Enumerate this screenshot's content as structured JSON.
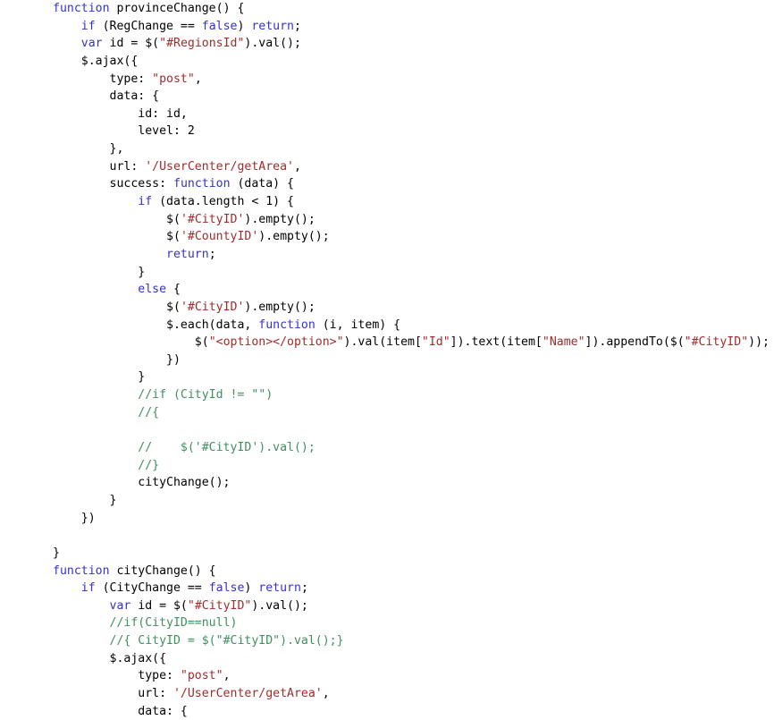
{
  "document": {
    "kind": "source-code-listing",
    "language": "javascript",
    "background": "#ffffff",
    "colors": {
      "plain": "#000000",
      "keyword": "#3333cc",
      "string": "#a02c2c",
      "comment": "#3f8f5f"
    },
    "indent_unit": "    ",
    "lines": [
      {
        "n": 1,
        "indent": 0,
        "tokens": [
          {
            "t": "kw",
            "v": "function"
          },
          {
            "t": "pln",
            "v": " provinceChange() {"
          }
        ]
      },
      {
        "n": 2,
        "indent": 1,
        "tokens": [
          {
            "t": "kw",
            "v": "if"
          },
          {
            "t": "pln",
            "v": " (RegChange == "
          },
          {
            "t": "kw",
            "v": "false"
          },
          {
            "t": "pln",
            "v": ") "
          },
          {
            "t": "kw",
            "v": "return"
          },
          {
            "t": "pln",
            "v": ";"
          }
        ]
      },
      {
        "n": 3,
        "indent": 1,
        "tokens": [
          {
            "t": "kw",
            "v": "var"
          },
          {
            "t": "pln",
            "v": " id = $("
          },
          {
            "t": "str",
            "v": "\"#RegionsId\""
          },
          {
            "t": "pln",
            "v": ").val();"
          }
        ]
      },
      {
        "n": 4,
        "indent": 1,
        "tokens": [
          {
            "t": "pln",
            "v": "$.ajax({"
          }
        ]
      },
      {
        "n": 5,
        "indent": 2,
        "tokens": [
          {
            "t": "pln",
            "v": "type: "
          },
          {
            "t": "str",
            "v": "\"post\""
          },
          {
            "t": "pln",
            "v": ","
          }
        ]
      },
      {
        "n": 6,
        "indent": 2,
        "tokens": [
          {
            "t": "pln",
            "v": "data: {"
          }
        ]
      },
      {
        "n": 7,
        "indent": 3,
        "tokens": [
          {
            "t": "pln",
            "v": "id: id,"
          }
        ]
      },
      {
        "n": 8,
        "indent": 3,
        "tokens": [
          {
            "t": "pln",
            "v": "level: 2"
          }
        ]
      },
      {
        "n": 9,
        "indent": 2,
        "tokens": [
          {
            "t": "pln",
            "v": "},"
          }
        ]
      },
      {
        "n": 10,
        "indent": 2,
        "tokens": [
          {
            "t": "pln",
            "v": "url: "
          },
          {
            "t": "str",
            "v": "'/UserCenter/getArea'"
          },
          {
            "t": "pln",
            "v": ","
          }
        ]
      },
      {
        "n": 11,
        "indent": 2,
        "tokens": [
          {
            "t": "pln",
            "v": "success: "
          },
          {
            "t": "kw",
            "v": "function"
          },
          {
            "t": "pln",
            "v": " (data) {"
          }
        ]
      },
      {
        "n": 12,
        "indent": 3,
        "tokens": [
          {
            "t": "kw",
            "v": "if"
          },
          {
            "t": "pln",
            "v": " (data.length < 1) {"
          }
        ]
      },
      {
        "n": 13,
        "indent": 4,
        "tokens": [
          {
            "t": "pln",
            "v": "$("
          },
          {
            "t": "str",
            "v": "'#CityID'"
          },
          {
            "t": "pln",
            "v": ").empty();"
          }
        ]
      },
      {
        "n": 14,
        "indent": 4,
        "tokens": [
          {
            "t": "pln",
            "v": "$("
          },
          {
            "t": "str",
            "v": "'#CountyID'"
          },
          {
            "t": "pln",
            "v": ").empty();"
          }
        ]
      },
      {
        "n": 15,
        "indent": 4,
        "tokens": [
          {
            "t": "kw",
            "v": "return"
          },
          {
            "t": "pln",
            "v": ";"
          }
        ]
      },
      {
        "n": 16,
        "indent": 3,
        "tokens": [
          {
            "t": "pln",
            "v": "}"
          }
        ]
      },
      {
        "n": 17,
        "indent": 3,
        "tokens": [
          {
            "t": "kw",
            "v": "else"
          },
          {
            "t": "pln",
            "v": " {"
          }
        ]
      },
      {
        "n": 18,
        "indent": 4,
        "tokens": [
          {
            "t": "pln",
            "v": "$("
          },
          {
            "t": "str",
            "v": "'#CityID'"
          },
          {
            "t": "pln",
            "v": ").empty();"
          }
        ]
      },
      {
        "n": 19,
        "indent": 4,
        "tokens": [
          {
            "t": "pln",
            "v": "$.each(data, "
          },
          {
            "t": "kw",
            "v": "function"
          },
          {
            "t": "pln",
            "v": " (i, item) {"
          }
        ]
      },
      {
        "n": 20,
        "indent": 5,
        "tokens": [
          {
            "t": "pln",
            "v": "$("
          },
          {
            "t": "str",
            "v": "\"<option></option>\""
          },
          {
            "t": "pln",
            "v": ").val(item["
          },
          {
            "t": "str",
            "v": "\"Id\""
          },
          {
            "t": "pln",
            "v": "]).text(item["
          },
          {
            "t": "str",
            "v": "\"Name\""
          },
          {
            "t": "pln",
            "v": "]).appendTo($("
          },
          {
            "t": "str",
            "v": "\"#CityID\""
          },
          {
            "t": "pln",
            "v": "));"
          }
        ]
      },
      {
        "n": 21,
        "indent": 4,
        "tokens": [
          {
            "t": "pln",
            "v": "})"
          }
        ]
      },
      {
        "n": 22,
        "indent": 3,
        "tokens": [
          {
            "t": "pln",
            "v": "}"
          }
        ]
      },
      {
        "n": 23,
        "indent": 3,
        "tokens": [
          {
            "t": "com",
            "v": "//if (CityId != \"\")"
          }
        ]
      },
      {
        "n": 24,
        "indent": 3,
        "tokens": [
          {
            "t": "com",
            "v": "//{"
          }
        ]
      },
      {
        "n": 25,
        "indent": 0,
        "tokens": []
      },
      {
        "n": 26,
        "indent": 3,
        "tokens": [
          {
            "t": "com",
            "v": "//    $('#CityID').val();"
          }
        ]
      },
      {
        "n": 27,
        "indent": 3,
        "tokens": [
          {
            "t": "com",
            "v": "//}"
          }
        ]
      },
      {
        "n": 28,
        "indent": 3,
        "tokens": [
          {
            "t": "pln",
            "v": "cityChange();"
          }
        ]
      },
      {
        "n": 29,
        "indent": 2,
        "tokens": [
          {
            "t": "pln",
            "v": "}"
          }
        ]
      },
      {
        "n": 30,
        "indent": 1,
        "tokens": [
          {
            "t": "pln",
            "v": "})"
          }
        ]
      },
      {
        "n": 31,
        "indent": 0,
        "tokens": []
      },
      {
        "n": 32,
        "indent": 0,
        "tokens": [
          {
            "t": "pln",
            "v": "}"
          }
        ]
      },
      {
        "n": 33,
        "indent": 0,
        "tokens": [
          {
            "t": "kw",
            "v": "function"
          },
          {
            "t": "pln",
            "v": " cityChange() {"
          }
        ]
      },
      {
        "n": 34,
        "indent": 1,
        "tokens": [
          {
            "t": "kw",
            "v": "if"
          },
          {
            "t": "pln",
            "v": " (CityChange == "
          },
          {
            "t": "kw",
            "v": "false"
          },
          {
            "t": "pln",
            "v": ") "
          },
          {
            "t": "kw",
            "v": "return"
          },
          {
            "t": "pln",
            "v": ";"
          }
        ]
      },
      {
        "n": 35,
        "indent": 2,
        "tokens": [
          {
            "t": "kw",
            "v": "var"
          },
          {
            "t": "pln",
            "v": " id = $("
          },
          {
            "t": "str",
            "v": "\"#CityID\""
          },
          {
            "t": "pln",
            "v": ").val();"
          }
        ]
      },
      {
        "n": 36,
        "indent": 2,
        "tokens": [
          {
            "t": "com",
            "v": "//if(CityID==null)"
          }
        ]
      },
      {
        "n": 37,
        "indent": 2,
        "tokens": [
          {
            "t": "com",
            "v": "//{ CityID = $(\"#CityID\").val();}"
          }
        ]
      },
      {
        "n": 38,
        "indent": 2,
        "tokens": [
          {
            "t": "pln",
            "v": "$.ajax({"
          }
        ]
      },
      {
        "n": 39,
        "indent": 3,
        "tokens": [
          {
            "t": "pln",
            "v": "type: "
          },
          {
            "t": "str",
            "v": "\"post\""
          },
          {
            "t": "pln",
            "v": ","
          }
        ]
      },
      {
        "n": 40,
        "indent": 3,
        "tokens": [
          {
            "t": "pln",
            "v": "url: "
          },
          {
            "t": "str",
            "v": "'/UserCenter/getArea'"
          },
          {
            "t": "pln",
            "v": ","
          }
        ]
      },
      {
        "n": 41,
        "indent": 3,
        "tokens": [
          {
            "t": "pln",
            "v": "data: {"
          }
        ]
      }
    ]
  }
}
